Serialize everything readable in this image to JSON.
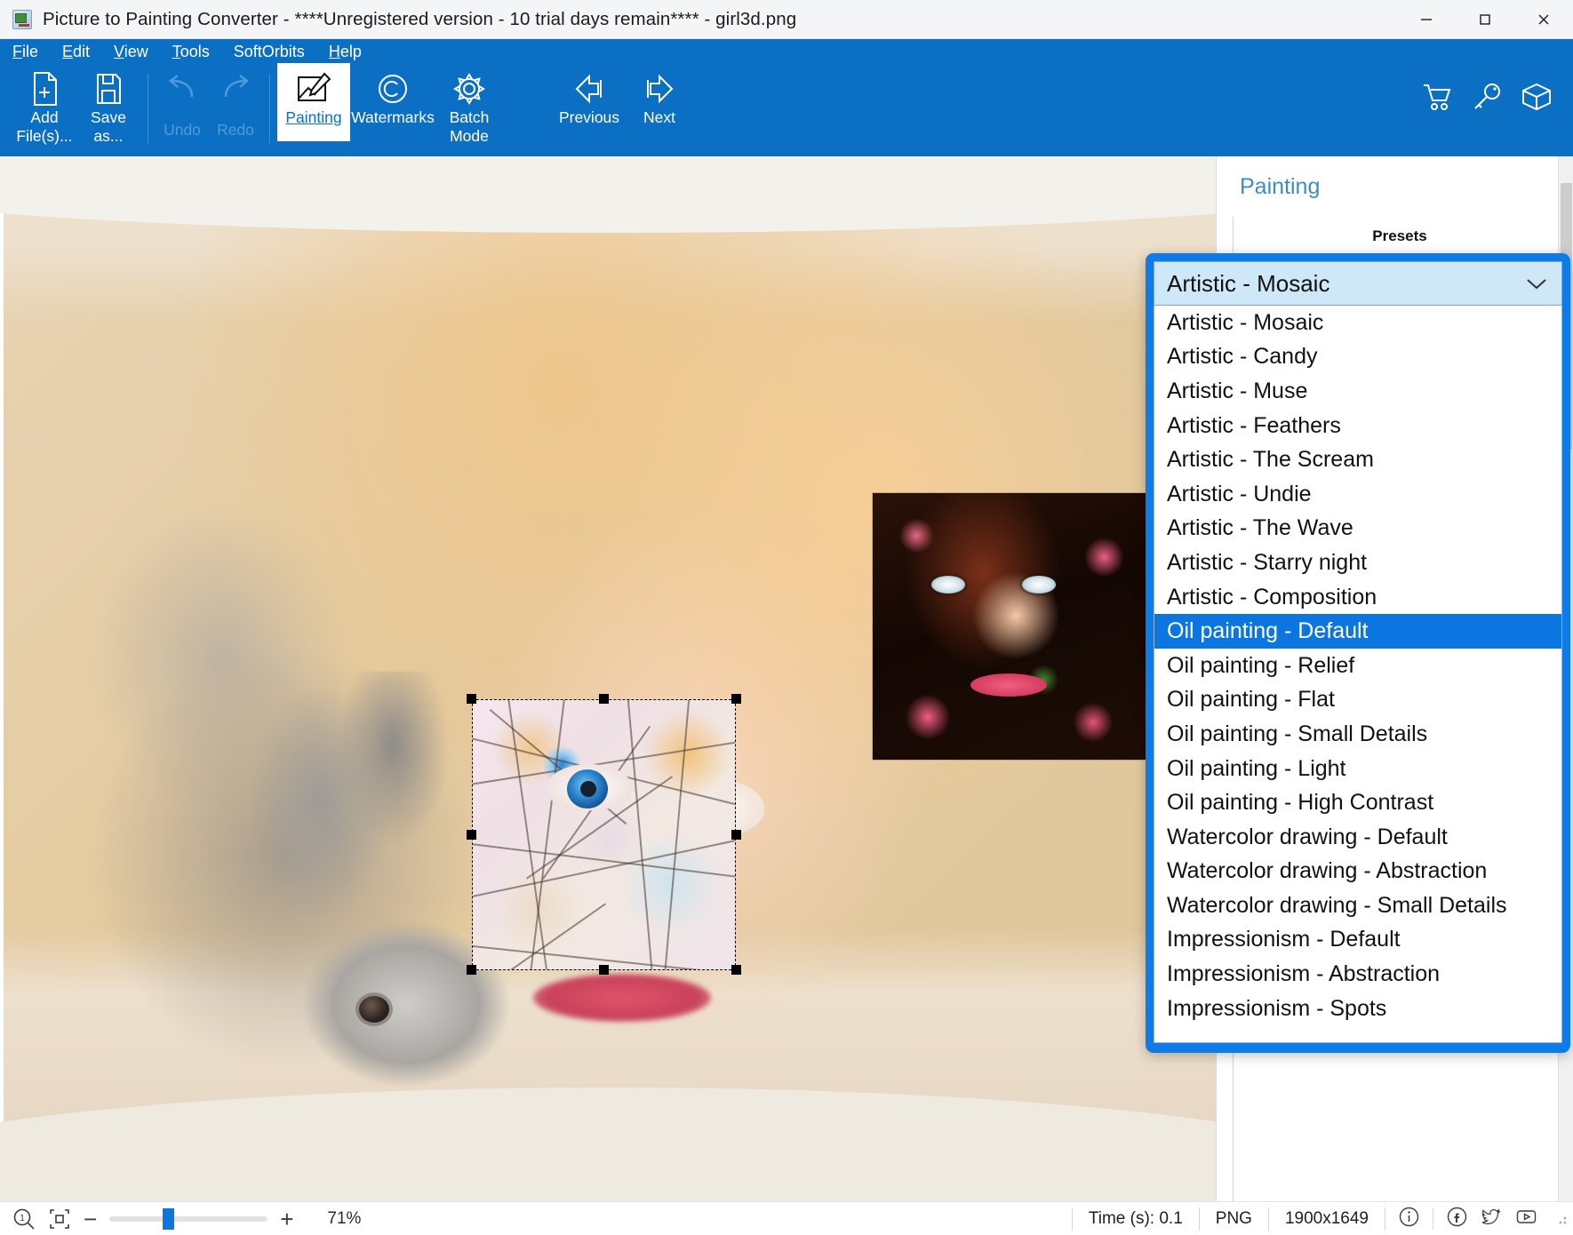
{
  "window": {
    "title": "Picture to Painting Converter - ****Unregistered version - 10 trial days remain**** - girl3d.png",
    "app_icon": "app-icon",
    "minimize": "minimize-icon",
    "maximize": "maximize-icon",
    "close": "close-icon"
  },
  "menubar": {
    "items": [
      {
        "label": "File",
        "accel": "F"
      },
      {
        "label": "Edit",
        "accel": "E"
      },
      {
        "label": "View",
        "accel": "V"
      },
      {
        "label": "Tools",
        "accel": "T"
      },
      {
        "label": "SoftOrbits",
        "accel": ""
      },
      {
        "label": "Help",
        "accel": "H"
      }
    ]
  },
  "toolbar": {
    "buttons": [
      {
        "name": "add-files",
        "line1": "Add",
        "line2": "File(s)...",
        "icon": "add-file-icon",
        "state": "normal"
      },
      {
        "name": "save-as",
        "line1": "Save",
        "line2": "as...",
        "icon": "save-icon",
        "state": "normal"
      },
      {
        "name": "undo",
        "line1": "Undo",
        "line2": "",
        "icon": "undo-icon",
        "state": "disabled"
      },
      {
        "name": "redo",
        "line1": "Redo",
        "line2": "",
        "icon": "redo-icon",
        "state": "disabled"
      },
      {
        "name": "painting",
        "line1": "Painting",
        "line2": "",
        "icon": "painting-icon",
        "state": "active"
      },
      {
        "name": "watermarks",
        "line1": "Watermarks",
        "line2": "",
        "icon": "copyright-icon",
        "state": "normal"
      },
      {
        "name": "batch-mode",
        "line1": "Batch",
        "line2": "Mode",
        "icon": "gear-icon",
        "state": "normal"
      },
      {
        "name": "previous",
        "line1": "Previous",
        "line2": "",
        "icon": "arrow-left-icon",
        "state": "normal"
      },
      {
        "name": "next",
        "line1": "Next",
        "line2": "",
        "icon": "arrow-right-icon",
        "state": "normal"
      }
    ],
    "right_icons": [
      {
        "name": "cart-icon",
        "title": "Buy"
      },
      {
        "name": "key-icon",
        "title": "Register"
      },
      {
        "name": "box-icon",
        "title": "Products"
      }
    ]
  },
  "panel": {
    "title": "Painting",
    "presets_label": "Presets"
  },
  "combo": {
    "name": "presets-combobox",
    "selected": "Artistic - Mosaic",
    "chevron": "chevron-down-icon",
    "highlighted": "Oil painting - Default",
    "options": [
      "Artistic - Mosaic",
      "Artistic - Candy",
      "Artistic - Muse",
      "Artistic - Feathers",
      "Artistic - The Scream",
      "Artistic - Undie",
      "Artistic - The Wave",
      "Artistic - Starry night",
      "Artistic - Composition",
      "Oil painting - Default",
      "Oil painting - Relief",
      "Oil painting - Flat",
      "Oil painting - Small Details",
      "Oil painting - Light",
      "Oil painting - High Contrast",
      "Watercolor drawing - Default",
      "Watercolor drawing - Abstraction",
      "Watercolor drawing - Small Details",
      "Impressionism - Default",
      "Impressionism - Abstraction",
      "Impressionism - Spots"
    ]
  },
  "statusbar": {
    "zoom_icon": "zoom-one-to-one-icon",
    "fit_icon": "fit-to-window-icon",
    "minus": "−",
    "plus": "+",
    "zoom_percent": "71%",
    "time": "Time (s): 0.1",
    "format": "PNG",
    "dimensions": "1900x1649",
    "social": [
      {
        "name": "info-icon"
      },
      {
        "name": "facebook-icon"
      },
      {
        "name": "twitter-icon"
      },
      {
        "name": "youtube-icon"
      }
    ]
  },
  "canvas": {
    "name": "image-canvas",
    "selection": {
      "name": "mosaic-preview-selection",
      "handles": 8
    },
    "preview_thumb": {
      "name": "effect-preview-thumbnail"
    }
  }
}
